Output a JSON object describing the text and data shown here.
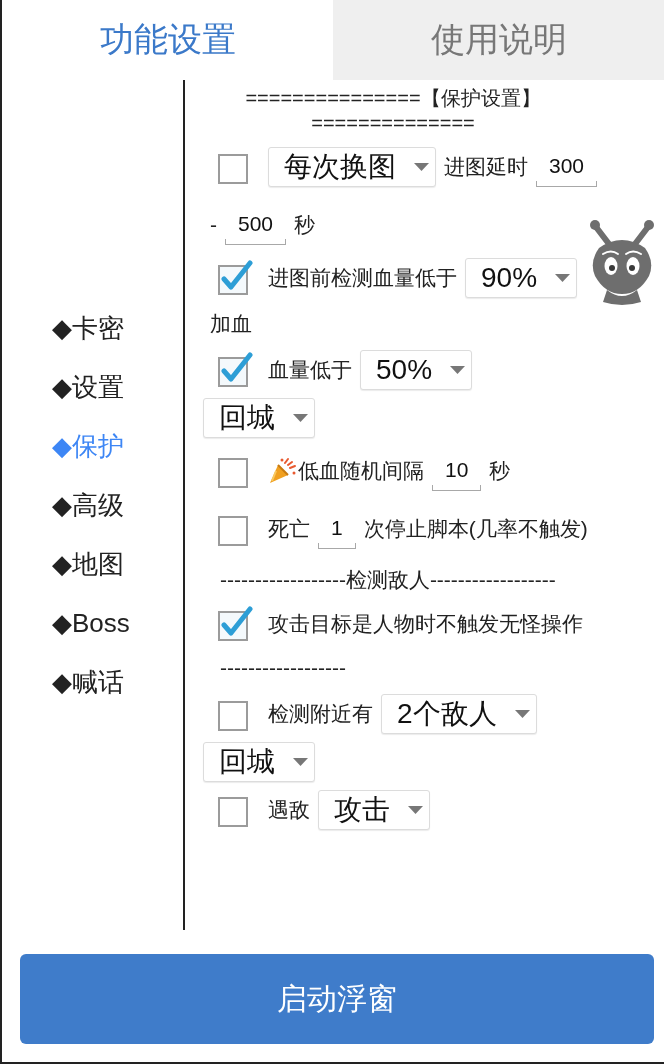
{
  "tabs": [
    {
      "label": "功能设置",
      "selected": true
    },
    {
      "label": "使用说明",
      "selected": false
    }
  ],
  "sidebar": {
    "items": [
      {
        "label": "◆卡密",
        "selected": false
      },
      {
        "label": "◆设置",
        "selected": false
      },
      {
        "label": "◆保护",
        "selected": true
      },
      {
        "label": "◆高级",
        "selected": false
      },
      {
        "label": "◆地图",
        "selected": false
      },
      {
        "label": "◆Boss",
        "selected": false
      },
      {
        "label": "◆喊话",
        "selected": false
      }
    ]
  },
  "panel": {
    "header_lines": [
      "===============【保护设置】",
      "=============="
    ],
    "lines": [
      {
        "parts": [
          {
            "kind": "checkbox",
            "checked": false
          },
          {
            "kind": "select",
            "value": "每次换图"
          },
          {
            "kind": "text",
            "text": "进图延时"
          },
          {
            "kind": "input",
            "value": "300"
          }
        ]
      },
      {
        "parts": [
          {
            "kind": "text",
            "text": "-"
          },
          {
            "kind": "input",
            "value": "500"
          },
          {
            "kind": "text",
            "text": "秒"
          }
        ]
      },
      {
        "parts": [
          {
            "kind": "checkbox",
            "checked": true
          },
          {
            "kind": "text",
            "text": "进图前检测血量低于"
          },
          {
            "kind": "select",
            "value": "90%"
          }
        ]
      },
      {
        "parts": [
          {
            "kind": "text",
            "text": "加血"
          }
        ]
      },
      {
        "parts": [
          {
            "kind": "checkbox",
            "checked": true
          },
          {
            "kind": "text",
            "text": "血量低于"
          },
          {
            "kind": "select",
            "value": "50%"
          }
        ]
      },
      {
        "parts": [
          {
            "kind": "select",
            "value": "回城"
          }
        ]
      },
      {
        "parts": [
          {
            "kind": "checkbox",
            "checked": false
          },
          {
            "kind": "icon"
          },
          {
            "kind": "text",
            "text": "低血随机间隔"
          },
          {
            "kind": "input",
            "value": "10"
          },
          {
            "kind": "text",
            "text": "秒"
          }
        ]
      },
      {
        "parts": [
          {
            "kind": "checkbox",
            "checked": false
          },
          {
            "kind": "text",
            "text": "死亡"
          },
          {
            "kind": "input",
            "value": "1"
          },
          {
            "kind": "text",
            "text": "次停止脚本(几率不触发)"
          }
        ]
      },
      {
        "parts": [
          {
            "kind": "divider",
            "text": "------------------检测敌人------------------"
          }
        ]
      },
      {
        "parts": [
          {
            "kind": "checkbox",
            "checked": true
          },
          {
            "kind": "text",
            "text": "攻击目标是人物时不触发无怪操作"
          }
        ]
      },
      {
        "parts": [
          {
            "kind": "divider",
            "text": "------------------"
          }
        ]
      },
      {
        "parts": [
          {
            "kind": "checkbox",
            "checked": false
          },
          {
            "kind": "text",
            "text": "检测附近有"
          },
          {
            "kind": "select",
            "value": "2个敌人"
          }
        ]
      },
      {
        "parts": [
          {
            "kind": "select",
            "value": "回城"
          }
        ]
      },
      {
        "parts": [
          {
            "kind": "checkbox",
            "checked": false
          },
          {
            "kind": "text",
            "text": "遇敌"
          },
          {
            "kind": "select",
            "value": "攻击"
          }
        ]
      }
    ]
  },
  "start_button": {
    "label": "启动浮窗"
  }
}
